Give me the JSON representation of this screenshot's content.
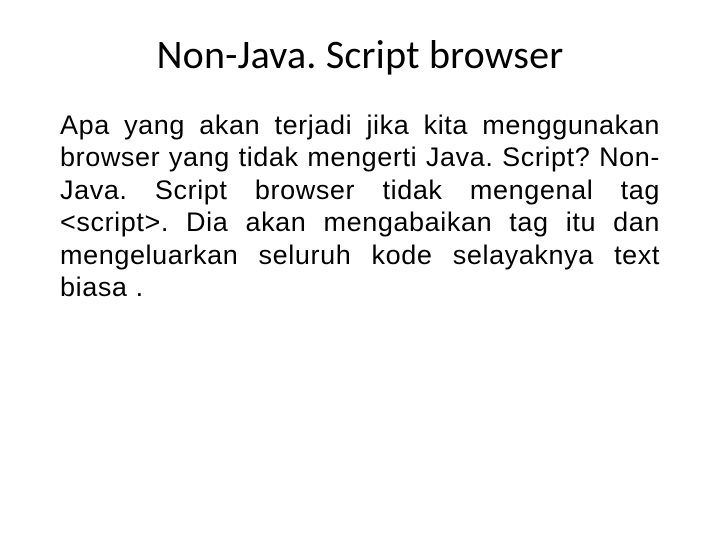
{
  "title": "Non-Java. Script browser",
  "body": "Apa yang akan terjadi jika kita menggunakan browser yang tidak mengerti Java. Script? Non-Java. Script browser tidak mengenal tag <script>. Dia akan mengabaikan tag itu dan mengeluarkan seluruh kode selayaknya text biasa ."
}
